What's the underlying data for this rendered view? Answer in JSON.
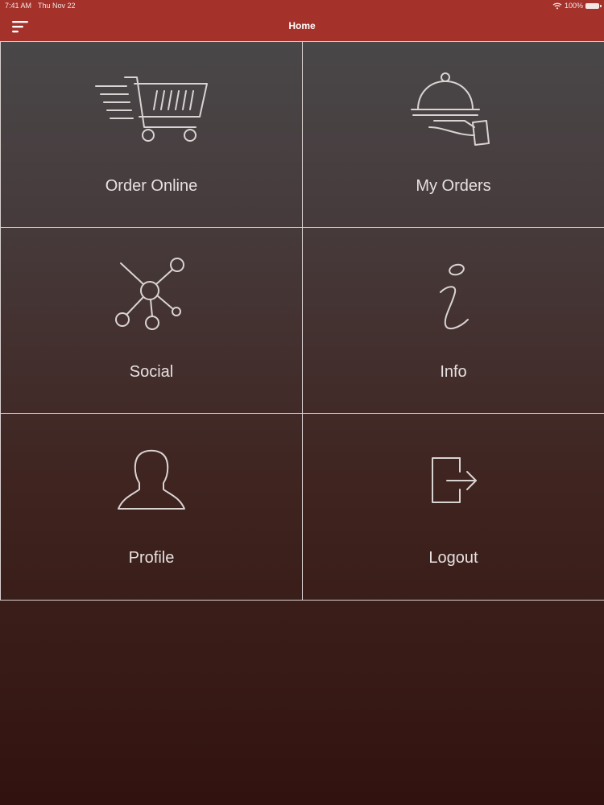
{
  "status_bar": {
    "time": "7:41 AM",
    "date": "Thu Nov 22",
    "battery": "100%"
  },
  "nav": {
    "title": "Home"
  },
  "tiles": [
    {
      "label": "Order Online",
      "icon": "shopping-cart-icon"
    },
    {
      "label": "My Orders",
      "icon": "serving-cloche-icon"
    },
    {
      "label": "Social",
      "icon": "network-icon"
    },
    {
      "label": "Info",
      "icon": "info-icon"
    },
    {
      "label": "Profile",
      "icon": "user-profile-icon"
    },
    {
      "label": "Logout",
      "icon": "logout-icon"
    }
  ],
  "colors": {
    "header": "#a4322b",
    "background_top": "#4a4a4c",
    "background_bottom": "#32120e",
    "text": "#e6e1e0"
  }
}
